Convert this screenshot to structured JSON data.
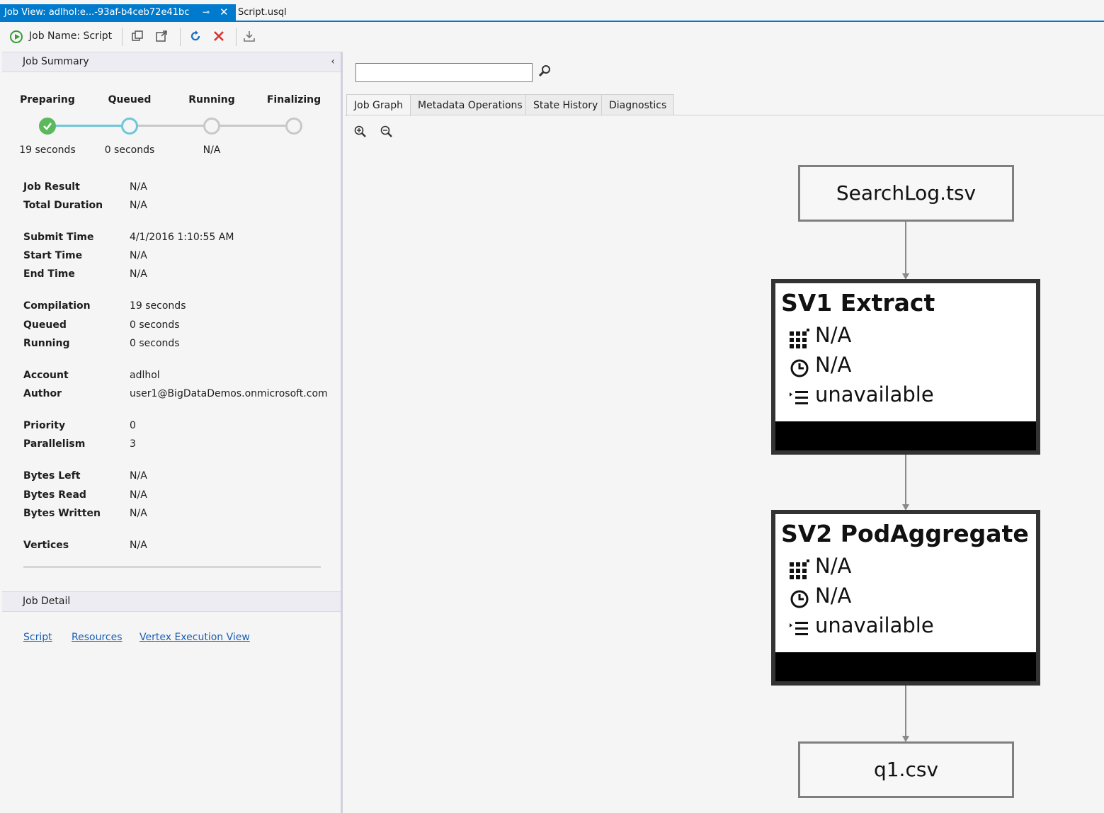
{
  "tabs": {
    "active": "Job View: adlhol:e...-93af-b4ceb72e41bc",
    "inactive": "Script.usql",
    "pin_glyph": "⊸",
    "close_glyph": "✕"
  },
  "toolbar": {
    "job_name": "Job Name: Script"
  },
  "summary": {
    "header": "Job Summary",
    "collapse_glyph": "‹",
    "stages": [
      {
        "label": "Preparing",
        "time": "19 seconds"
      },
      {
        "label": "Queued",
        "time": "0 seconds"
      },
      {
        "label": "Running",
        "time": "N/A"
      },
      {
        "label": "Finalizing",
        "time": ""
      }
    ],
    "fields": [
      {
        "label": "Job Result",
        "value": "N/A"
      },
      {
        "label": "Total Duration",
        "value": "N/A"
      },
      {
        "label": "Submit Time",
        "value": "4/1/2016 1:10:55 AM"
      },
      {
        "label": "Start Time",
        "value": "N/A"
      },
      {
        "label": "End Time",
        "value": "N/A"
      },
      {
        "label": "Compilation",
        "value": "19 seconds"
      },
      {
        "label": "Queued",
        "value": "0 seconds"
      },
      {
        "label": "Running",
        "value": "0 seconds"
      },
      {
        "label": "Account",
        "value": "adlhol"
      },
      {
        "label": "Author",
        "value": "user1@BigDataDemos.onmicrosoft.com"
      },
      {
        "label": "Priority",
        "value": "0"
      },
      {
        "label": "Parallelism",
        "value": "3"
      },
      {
        "label": "Bytes Left",
        "value": "N/A"
      },
      {
        "label": "Bytes Read",
        "value": "N/A"
      },
      {
        "label": "Bytes Written",
        "value": "N/A"
      },
      {
        "label": "Vertices",
        "value": "N/A"
      }
    ]
  },
  "detail": {
    "header": "Job Detail",
    "links": [
      "Script",
      "Resources",
      "Vertex Execution View"
    ]
  },
  "graph_tabs": [
    "Job Graph",
    "Metadata Operations",
    "State History",
    "Diagnostics"
  ],
  "search": {
    "value": "",
    "placeholder": ""
  },
  "graph": {
    "input": "SearchLog.tsv",
    "output": "q1.csv",
    "vertices": [
      {
        "title": "SV1 Extract",
        "vertices": "N/A",
        "time": "N/A",
        "rows": "unavailable"
      },
      {
        "title": "SV2 PodAggregate",
        "vertices": "N/A",
        "time": "N/A",
        "rows": "unavailable"
      }
    ]
  },
  "colors": {
    "accent": "#007acc",
    "done": "#5cb85c",
    "current": "#6ec6d8",
    "link": "#1a5fb4"
  }
}
